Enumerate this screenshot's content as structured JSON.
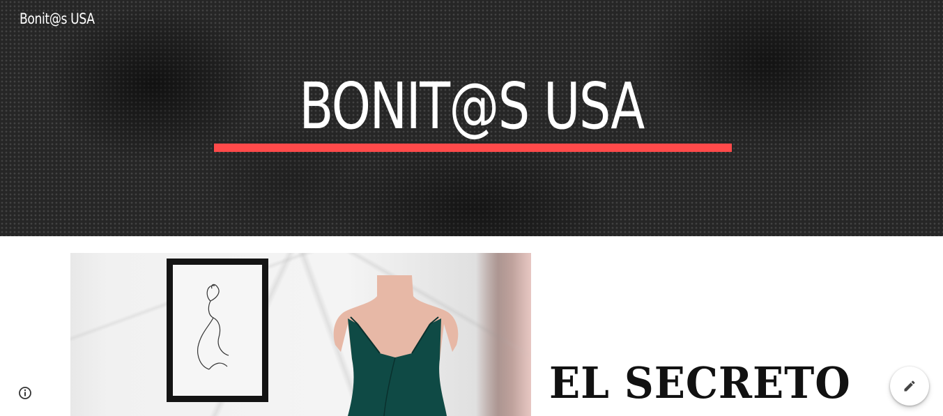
{
  "header": {
    "site_name": "Bonit@s USA",
    "hero_title": "BONIT@S USA",
    "accent_color": "#ff4a4a"
  },
  "main": {
    "featured_image": {
      "icon": "product-photo",
      "description_colors": {
        "dress": "#0f4a45",
        "mannequin": "#e7b8a6"
      }
    },
    "promo_title": "EL SECRETO"
  },
  "footer": {
    "info_icon": "info-icon",
    "edit_icon": "pencil-icon"
  }
}
